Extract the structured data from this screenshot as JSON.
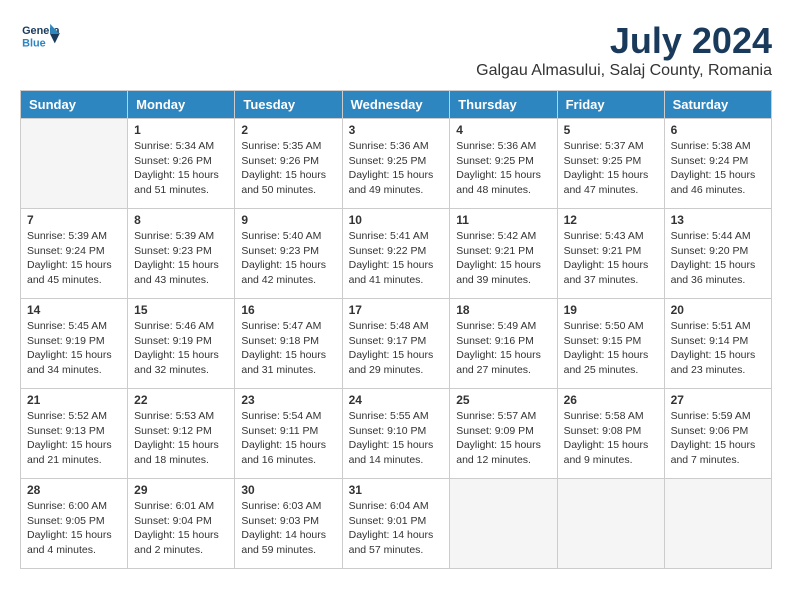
{
  "logo": {
    "line1": "General",
    "line2": "Blue"
  },
  "title": "July 2024",
  "location": "Galgau Almasului, Salaj County, Romania",
  "weekdays": [
    "Sunday",
    "Monday",
    "Tuesday",
    "Wednesday",
    "Thursday",
    "Friday",
    "Saturday"
  ],
  "weeks": [
    [
      {
        "day": "",
        "info": ""
      },
      {
        "day": "1",
        "info": "Sunrise: 5:34 AM\nSunset: 9:26 PM\nDaylight: 15 hours\nand 51 minutes."
      },
      {
        "day": "2",
        "info": "Sunrise: 5:35 AM\nSunset: 9:26 PM\nDaylight: 15 hours\nand 50 minutes."
      },
      {
        "day": "3",
        "info": "Sunrise: 5:36 AM\nSunset: 9:25 PM\nDaylight: 15 hours\nand 49 minutes."
      },
      {
        "day": "4",
        "info": "Sunrise: 5:36 AM\nSunset: 9:25 PM\nDaylight: 15 hours\nand 48 minutes."
      },
      {
        "day": "5",
        "info": "Sunrise: 5:37 AM\nSunset: 9:25 PM\nDaylight: 15 hours\nand 47 minutes."
      },
      {
        "day": "6",
        "info": "Sunrise: 5:38 AM\nSunset: 9:24 PM\nDaylight: 15 hours\nand 46 minutes."
      }
    ],
    [
      {
        "day": "7",
        "info": "Sunrise: 5:39 AM\nSunset: 9:24 PM\nDaylight: 15 hours\nand 45 minutes."
      },
      {
        "day": "8",
        "info": "Sunrise: 5:39 AM\nSunset: 9:23 PM\nDaylight: 15 hours\nand 43 minutes."
      },
      {
        "day": "9",
        "info": "Sunrise: 5:40 AM\nSunset: 9:23 PM\nDaylight: 15 hours\nand 42 minutes."
      },
      {
        "day": "10",
        "info": "Sunrise: 5:41 AM\nSunset: 9:22 PM\nDaylight: 15 hours\nand 41 minutes."
      },
      {
        "day": "11",
        "info": "Sunrise: 5:42 AM\nSunset: 9:21 PM\nDaylight: 15 hours\nand 39 minutes."
      },
      {
        "day": "12",
        "info": "Sunrise: 5:43 AM\nSunset: 9:21 PM\nDaylight: 15 hours\nand 37 minutes."
      },
      {
        "day": "13",
        "info": "Sunrise: 5:44 AM\nSunset: 9:20 PM\nDaylight: 15 hours\nand 36 minutes."
      }
    ],
    [
      {
        "day": "14",
        "info": "Sunrise: 5:45 AM\nSunset: 9:19 PM\nDaylight: 15 hours\nand 34 minutes."
      },
      {
        "day": "15",
        "info": "Sunrise: 5:46 AM\nSunset: 9:19 PM\nDaylight: 15 hours\nand 32 minutes."
      },
      {
        "day": "16",
        "info": "Sunrise: 5:47 AM\nSunset: 9:18 PM\nDaylight: 15 hours\nand 31 minutes."
      },
      {
        "day": "17",
        "info": "Sunrise: 5:48 AM\nSunset: 9:17 PM\nDaylight: 15 hours\nand 29 minutes."
      },
      {
        "day": "18",
        "info": "Sunrise: 5:49 AM\nSunset: 9:16 PM\nDaylight: 15 hours\nand 27 minutes."
      },
      {
        "day": "19",
        "info": "Sunrise: 5:50 AM\nSunset: 9:15 PM\nDaylight: 15 hours\nand 25 minutes."
      },
      {
        "day": "20",
        "info": "Sunrise: 5:51 AM\nSunset: 9:14 PM\nDaylight: 15 hours\nand 23 minutes."
      }
    ],
    [
      {
        "day": "21",
        "info": "Sunrise: 5:52 AM\nSunset: 9:13 PM\nDaylight: 15 hours\nand 21 minutes."
      },
      {
        "day": "22",
        "info": "Sunrise: 5:53 AM\nSunset: 9:12 PM\nDaylight: 15 hours\nand 18 minutes."
      },
      {
        "day": "23",
        "info": "Sunrise: 5:54 AM\nSunset: 9:11 PM\nDaylight: 15 hours\nand 16 minutes."
      },
      {
        "day": "24",
        "info": "Sunrise: 5:55 AM\nSunset: 9:10 PM\nDaylight: 15 hours\nand 14 minutes."
      },
      {
        "day": "25",
        "info": "Sunrise: 5:57 AM\nSunset: 9:09 PM\nDaylight: 15 hours\nand 12 minutes."
      },
      {
        "day": "26",
        "info": "Sunrise: 5:58 AM\nSunset: 9:08 PM\nDaylight: 15 hours\nand 9 minutes."
      },
      {
        "day": "27",
        "info": "Sunrise: 5:59 AM\nSunset: 9:06 PM\nDaylight: 15 hours\nand 7 minutes."
      }
    ],
    [
      {
        "day": "28",
        "info": "Sunrise: 6:00 AM\nSunset: 9:05 PM\nDaylight: 15 hours\nand 4 minutes."
      },
      {
        "day": "29",
        "info": "Sunrise: 6:01 AM\nSunset: 9:04 PM\nDaylight: 15 hours\nand 2 minutes."
      },
      {
        "day": "30",
        "info": "Sunrise: 6:03 AM\nSunset: 9:03 PM\nDaylight: 14 hours\nand 59 minutes."
      },
      {
        "day": "31",
        "info": "Sunrise: 6:04 AM\nSunset: 9:01 PM\nDaylight: 14 hours\nand 57 minutes."
      },
      {
        "day": "",
        "info": ""
      },
      {
        "day": "",
        "info": ""
      },
      {
        "day": "",
        "info": ""
      }
    ]
  ]
}
